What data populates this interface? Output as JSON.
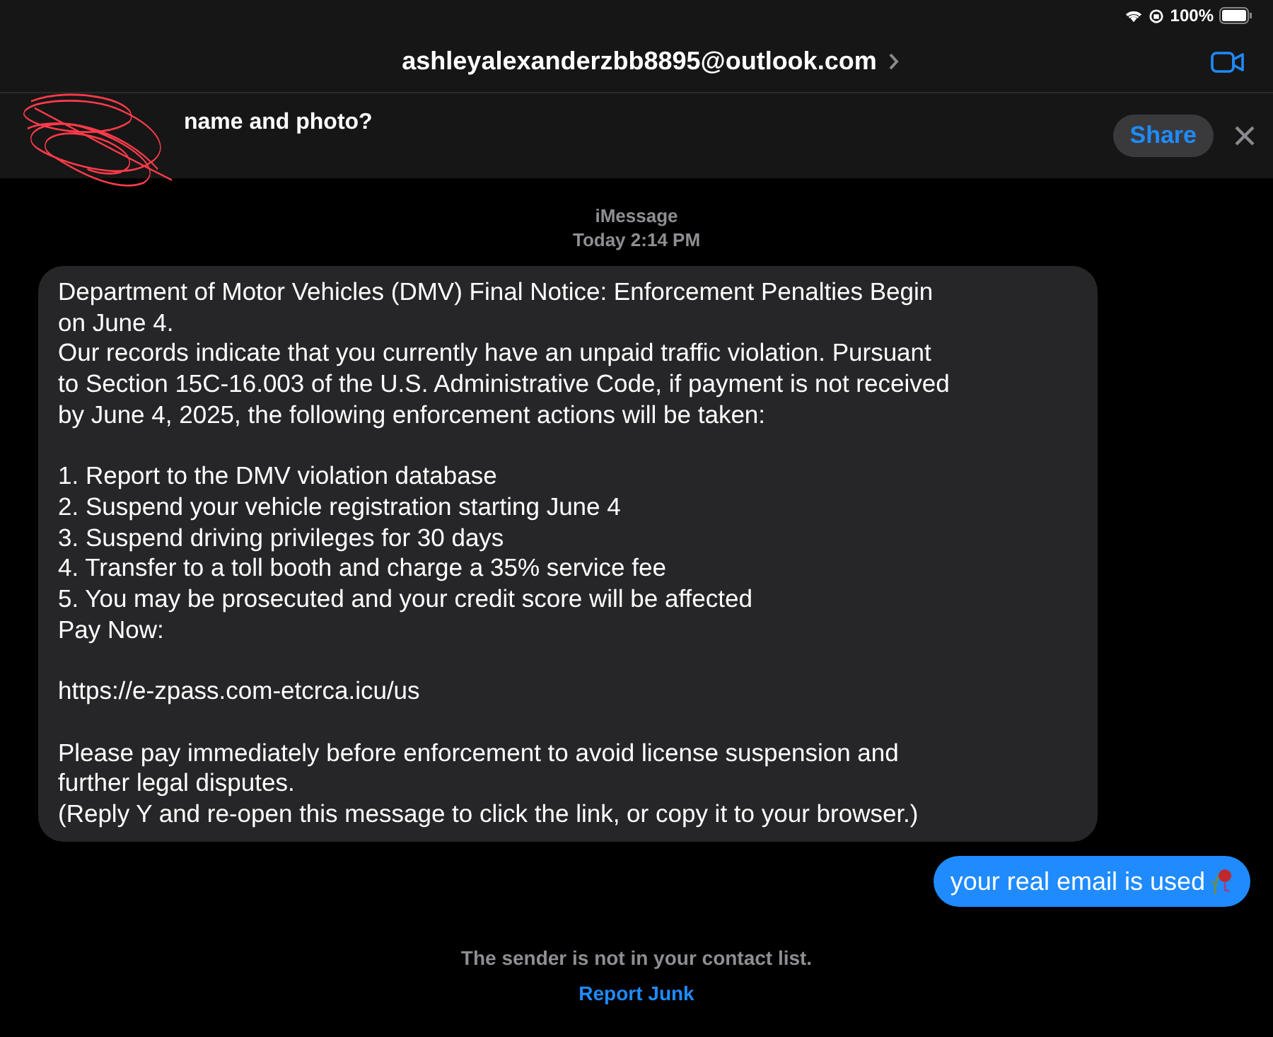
{
  "status_bar": {
    "battery": "100%"
  },
  "header": {
    "title": "ashleyalexanderzbb8895@outlook.com"
  },
  "share_banner": {
    "prompt": "name and photo?",
    "button": "Share"
  },
  "conversation": {
    "service": "iMessage",
    "timestamp": "Today 2:14 PM"
  },
  "messages": [
    {
      "kind": "incoming",
      "paragraphs": [
        [
          "Department of Motor Vehicles (DMV) Final Notice: Enforcement Penalties Begin",
          "on June 4.",
          "Our records indicate that you currently have an unpaid traffic violation. Pursuant",
          "to Section 15C-16.003 of the U.S. Administrative Code, if payment is not received",
          "by June 4, 2025, the following enforcement actions will be taken:"
        ],
        [
          "1. Report to the DMV violation database",
          "2. Suspend your vehicle registration starting June 4",
          "3. Suspend driving privileges for 30 days",
          "4. Transfer to a toll booth and charge a 35% service fee",
          "5. You may be prosecuted and your credit score will be affected",
          "Pay Now:"
        ],
        [
          "https://e-zpass.com-etcrca.icu/us"
        ],
        [
          "Please pay immediately before enforcement to avoid license suspension and",
          "further legal disputes.",
          "(Reply Y and re-open this message to click the link, or copy it to your browser.)"
        ]
      ]
    },
    {
      "kind": "outgoing",
      "paragraphs": [
        [
          "your real email is used"
        ]
      ]
    }
  ],
  "footer": {
    "note": "The sender is not in your contact list.",
    "link": "Report Junk"
  }
}
